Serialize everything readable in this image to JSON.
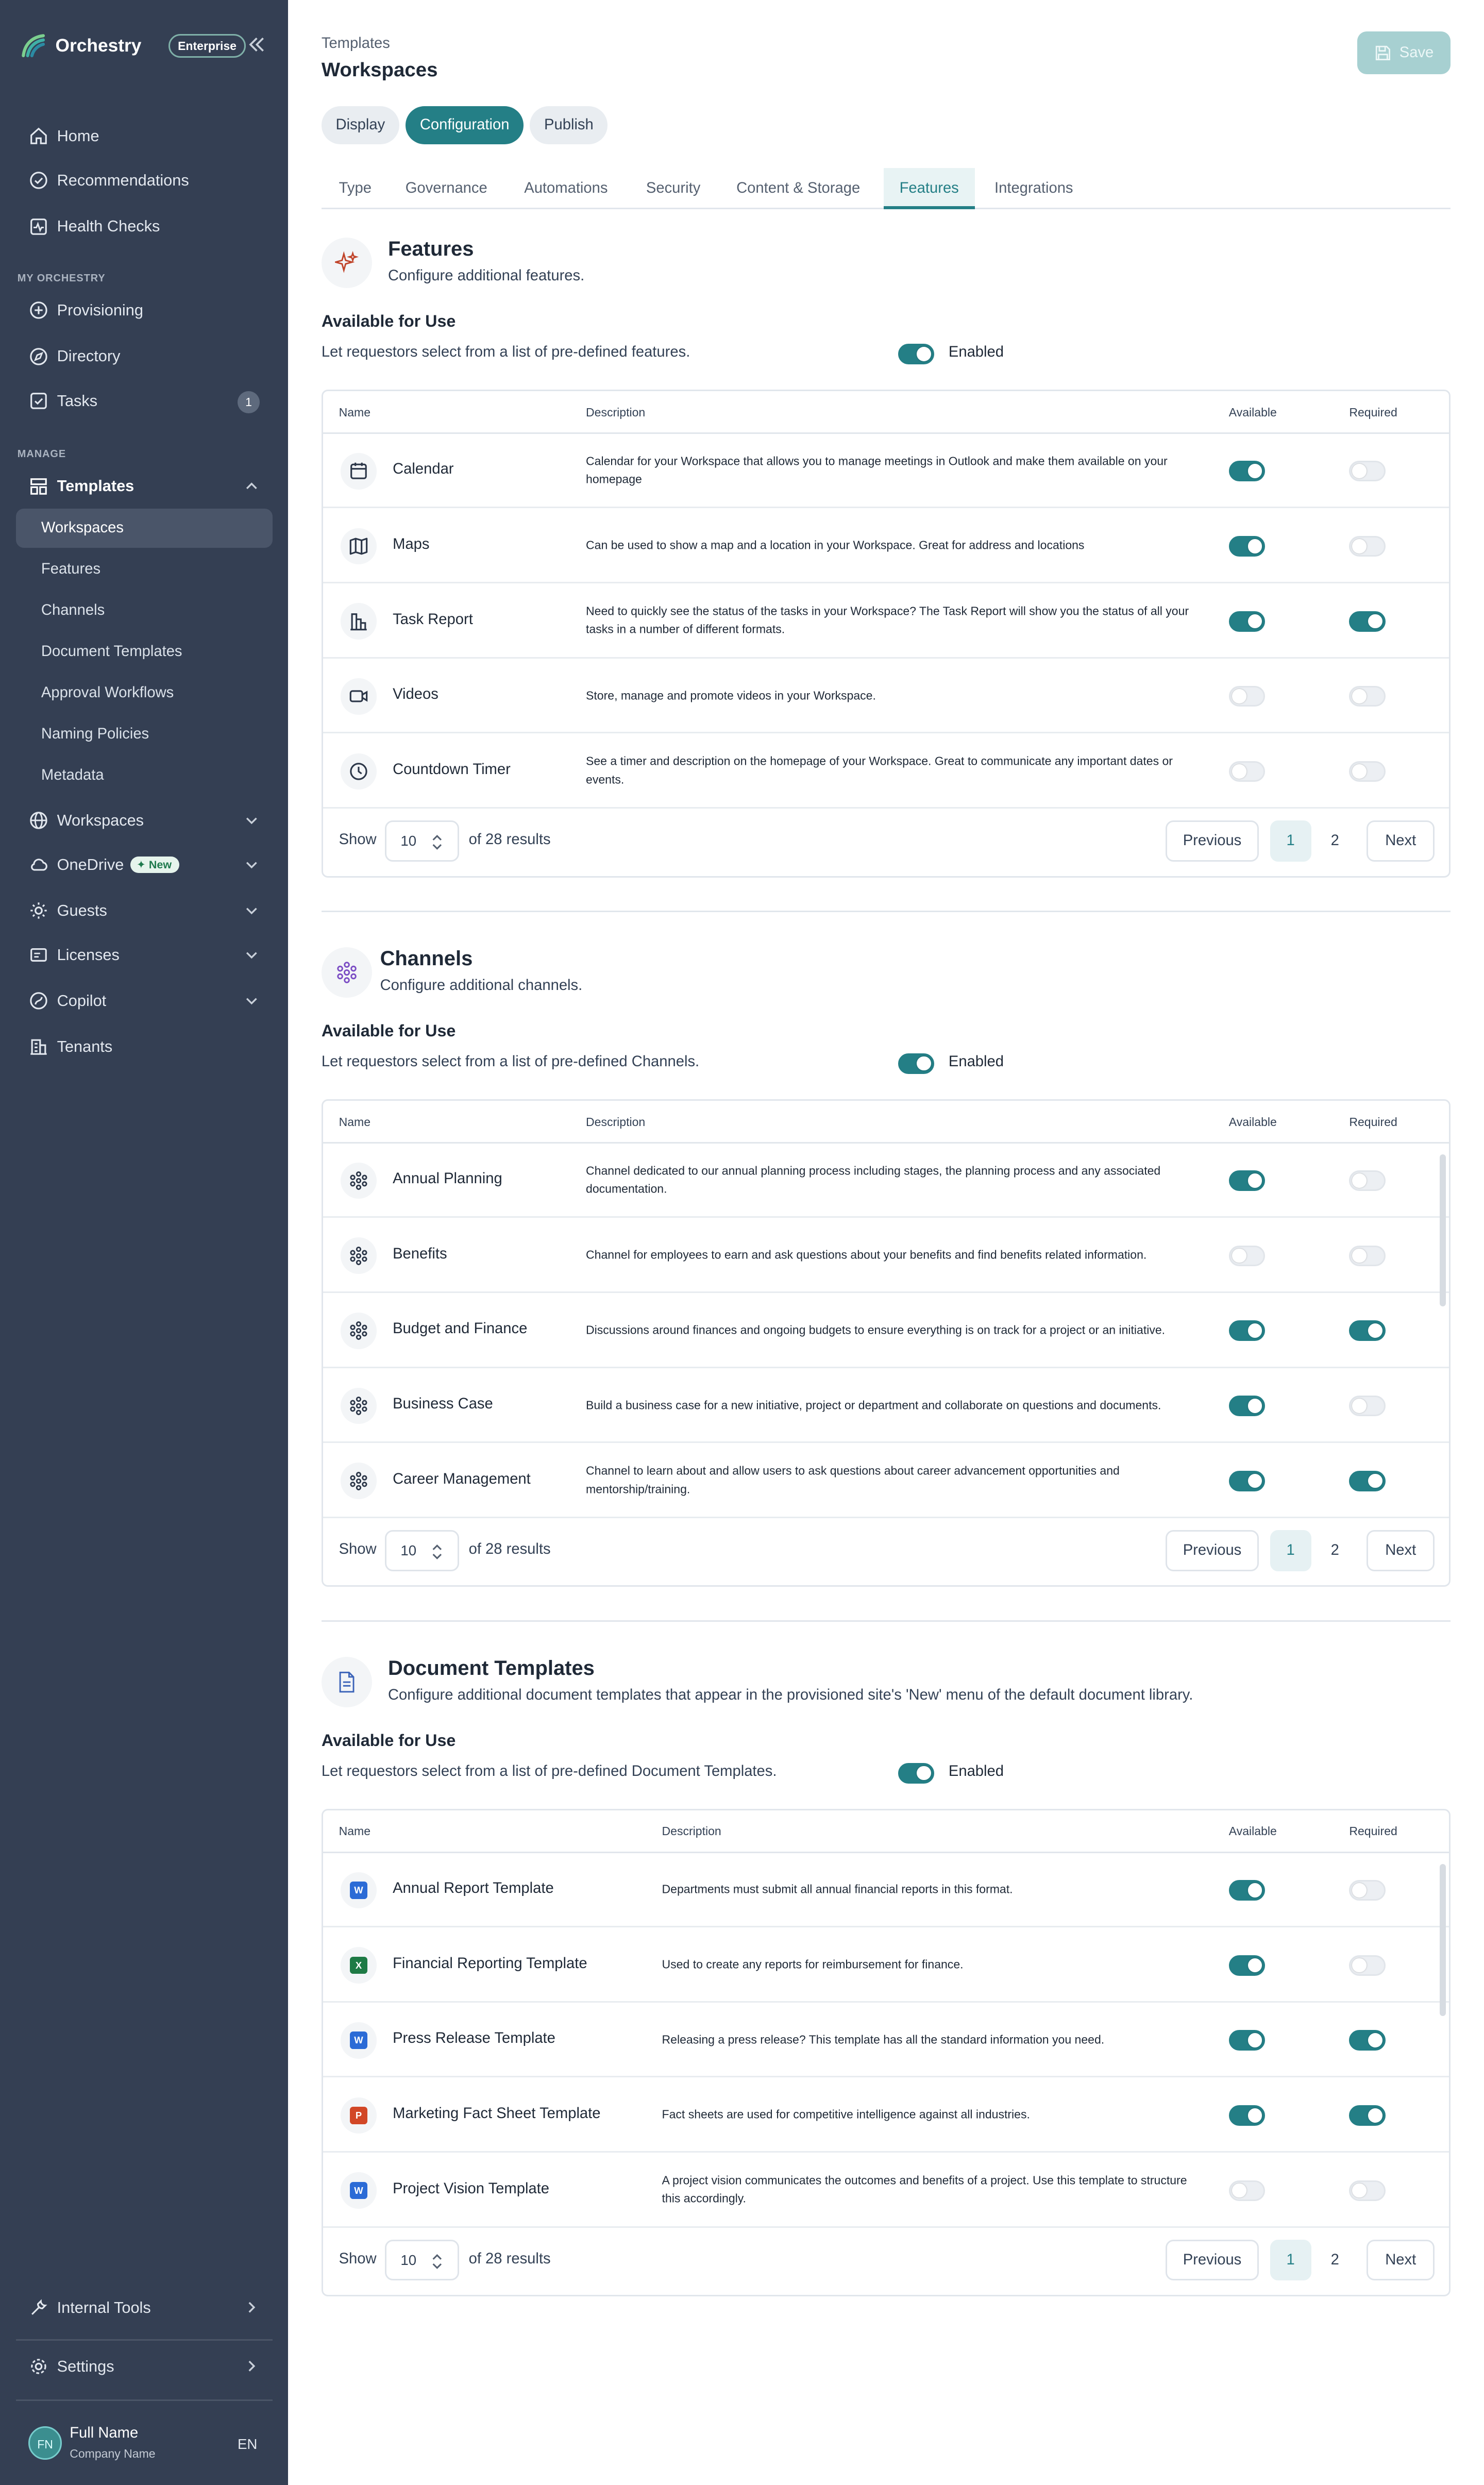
{
  "sidebar": {
    "brand": "Orchestry",
    "edition": "Enterprise",
    "nav_top": [
      {
        "label": "Home",
        "icon": "home-icon"
      },
      {
        "label": "Recommendations",
        "icon": "check-badge-icon"
      },
      {
        "label": "Health Checks",
        "icon": "heartbeat-icon"
      }
    ],
    "section_my": "MY ORCHESTRY",
    "nav_my": [
      {
        "label": "Provisioning",
        "icon": "plus-circle-icon"
      },
      {
        "label": "Directory",
        "icon": "compass-icon"
      },
      {
        "label": "Tasks",
        "icon": "checkbox-icon",
        "count": "1"
      }
    ],
    "section_manage": "MANAGE",
    "templates_label": "Templates",
    "templates_sub": [
      "Workspaces",
      "Features",
      "Channels",
      "Document Templates",
      "Approval Workflows",
      "Naming Policies",
      "Metadata"
    ],
    "nav_manage": [
      {
        "label": "Workspaces",
        "icon": "globe-icon"
      },
      {
        "label": "OneDrive",
        "icon": "cloud-icon",
        "badge": "New"
      },
      {
        "label": "Guests",
        "icon": "guests-icon"
      },
      {
        "label": "Licenses",
        "icon": "license-icon"
      },
      {
        "label": "Copilot",
        "icon": "copilot-icon"
      },
      {
        "label": "Tenants",
        "icon": "building-icon"
      }
    ],
    "internal_tools": "Internal Tools",
    "settings": "Settings",
    "user": {
      "initials": "FN",
      "name": "Full Name",
      "company": "Company Name",
      "lang": "EN"
    }
  },
  "header": {
    "breadcrumb": "Templates",
    "title": "Workspaces",
    "save_label": "Save"
  },
  "pill_tabs": [
    "Display",
    "Configuration",
    "Publish"
  ],
  "tabs": [
    "Type",
    "Governance",
    "Automations",
    "Security",
    "Content & Storage",
    "Features",
    "Integrations"
  ],
  "table_headers": {
    "name": "Name",
    "description": "Description",
    "available": "Available",
    "required": "Required"
  },
  "pager": {
    "show": "Show",
    "page_size": "10",
    "of_results": "of 28 results",
    "previous": "Previous",
    "page1": "1",
    "page2": "2",
    "next": "Next"
  },
  "enabled_label": "Enabled",
  "features": {
    "title": "Features",
    "description": "Configure additional features.",
    "avail_title": "Available for Use",
    "avail_desc": "Let requestors select from a list of pre-defined features.",
    "rows": [
      {
        "name": "Calendar",
        "icon": "calendar-icon",
        "description": "Calendar for your Workspace that allows you to manage meetings in Outlook and make them available on your homepage",
        "available": true,
        "required": false
      },
      {
        "name": "Maps",
        "icon": "map-icon",
        "description": "Can be used to show a map and a location in your Workspace. Great for address and locations",
        "available": true,
        "required": false
      },
      {
        "name": "Task Report",
        "icon": "bar-chart-icon",
        "description": "Need to quickly see the status of the tasks in your Workspace? The Task Report will show you the status of all your tasks in a number of different formats.",
        "available": true,
        "required": true
      },
      {
        "name": "Videos",
        "icon": "video-icon",
        "description": "Store, manage and promote videos in your Workspace.",
        "available": false,
        "required": false
      },
      {
        "name": "Countdown Timer",
        "icon": "clock-icon",
        "description": "See a timer and description on the homepage of your Workspace. Great to communicate any important dates or events.",
        "available": false,
        "required": false
      }
    ]
  },
  "channels": {
    "title": "Channels",
    "description": "Configure additional channels.",
    "avail_title": "Available for Use",
    "avail_desc": "Let requestors select from a list of pre-defined Channels.",
    "rows": [
      {
        "name": "Annual Planning",
        "icon": "channel-icon",
        "description": "Channel dedicated to our annual planning process including stages, the planning process and any associated documentation.",
        "available": true,
        "required": false
      },
      {
        "name": "Benefits",
        "icon": "channel-icon",
        "description": "Channel for employees to earn and ask questions about your benefits and find benefits related information.",
        "available": false,
        "required": false
      },
      {
        "name": "Budget and Finance",
        "icon": "channel-icon",
        "description": "Discussions around finances and ongoing budgets to ensure everything is on track for a project or an initiative.",
        "available": true,
        "required": true
      },
      {
        "name": "Business Case",
        "icon": "channel-icon",
        "description": "Build a business case for a new initiative, project or department and collaborate on questions and documents.",
        "available": true,
        "required": false
      },
      {
        "name": "Career Management",
        "icon": "channel-icon",
        "description": "Channel to learn about and allow users to ask questions about career advancement opportunities and mentorship/training.",
        "available": true,
        "required": true
      }
    ]
  },
  "doc_templates": {
    "title": "Document Templates",
    "description": "Configure additional document templates that appear in the provisioned site's 'New' menu of the default document library.",
    "avail_title": "Available for Use",
    "avail_desc": "Let requestors select from a list of pre-defined Document Templates.",
    "rows": [
      {
        "name": "Annual Report Template",
        "icon": "word-icon",
        "icon_color": "#2b6bd6",
        "description": "Departments must submit all annual financial reports in this format.",
        "available": true,
        "required": false
      },
      {
        "name": "Financial Reporting Template",
        "icon": "excel-icon",
        "icon_color": "#1e7a45",
        "description": "Used to create any reports for reimbursement for finance.",
        "available": true,
        "required": false
      },
      {
        "name": "Press Release Template",
        "icon": "word-icon",
        "icon_color": "#2b6bd6",
        "description": "Releasing a press release? This template has all the standard information you need.",
        "available": true,
        "required": true
      },
      {
        "name": "Marketing Fact Sheet Template",
        "icon": "powerpoint-icon",
        "icon_color": "#d24726",
        "description": "Fact sheets are used for competitive intelligence against all industries.",
        "available": true,
        "required": true
      },
      {
        "name": "Project Vision Template",
        "icon": "word-icon",
        "icon_color": "#2b6bd6",
        "description": "A project vision communicates the outcomes and benefits of a project. Use this template to structure this accordingly.",
        "available": false,
        "required": false
      }
    ]
  },
  "colors": {
    "sidebar_bg": "#343f53",
    "accent": "#247f86",
    "save_disabled": "#a7d0d1"
  }
}
